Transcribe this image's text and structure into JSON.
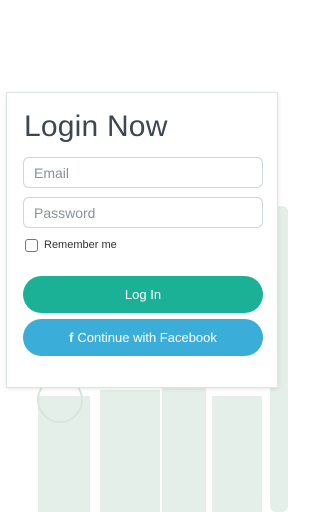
{
  "login": {
    "title": "Login Now",
    "email_placeholder": "Email",
    "password_placeholder": "Password",
    "remember_label": "Remember me",
    "login_button": "Log In",
    "facebook_button": "Continue with Facebook",
    "facebook_icon": "f"
  },
  "colors": {
    "primary": "#1ab197",
    "facebook": "#3badd9",
    "title": "#3e4654",
    "background_art": "#e4efe9"
  }
}
